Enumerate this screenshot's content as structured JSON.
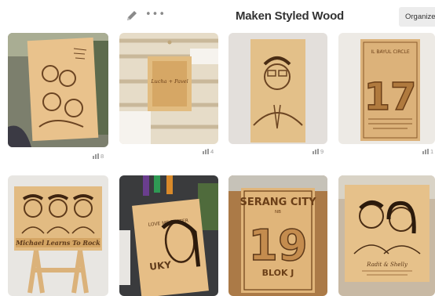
{
  "board": {
    "title": "Maken Styled Wood",
    "organize_label": "Organize",
    "more_glyph": "•••"
  },
  "colors": {
    "wood_light": "#e8c48e",
    "wood_mid": "#d7a86a",
    "wood_dark": "#8a5a2b",
    "button_bg": "#ececec"
  },
  "pins": [
    {
      "label": "family-portrait-engraving",
      "likes": "8"
    },
    {
      "label": "wedding-invite-plaque",
      "likes": "4"
    },
    {
      "label": "man-portrait-engraving",
      "likes": "9"
    },
    {
      "label": "number-17-plaque",
      "likes": "1"
    },
    {
      "label": "band-portrait-easel",
      "likes": ""
    },
    {
      "label": "woman-portrait-quote",
      "likes": ""
    },
    {
      "label": "serang-city-plaque",
      "likes": ""
    },
    {
      "label": "couple-portrait-engraving",
      "likes": ""
    }
  ],
  "engraved_text": {
    "pin2_names": "Lucha + Pavel",
    "pin4_header": "IL BAYUL CIRCLE",
    "pin4_number": "17",
    "pin5_banner": "Michael Learns To Rock",
    "pin6_quote": "LOVE ME BETTER",
    "pin6_name": "UKY",
    "pin7_city": "SERANG CITY",
    "pin7_nb": "NB",
    "pin7_number": "19",
    "pin7_block": "BLOK J",
    "pin8_names": "Radit & Shelly"
  }
}
